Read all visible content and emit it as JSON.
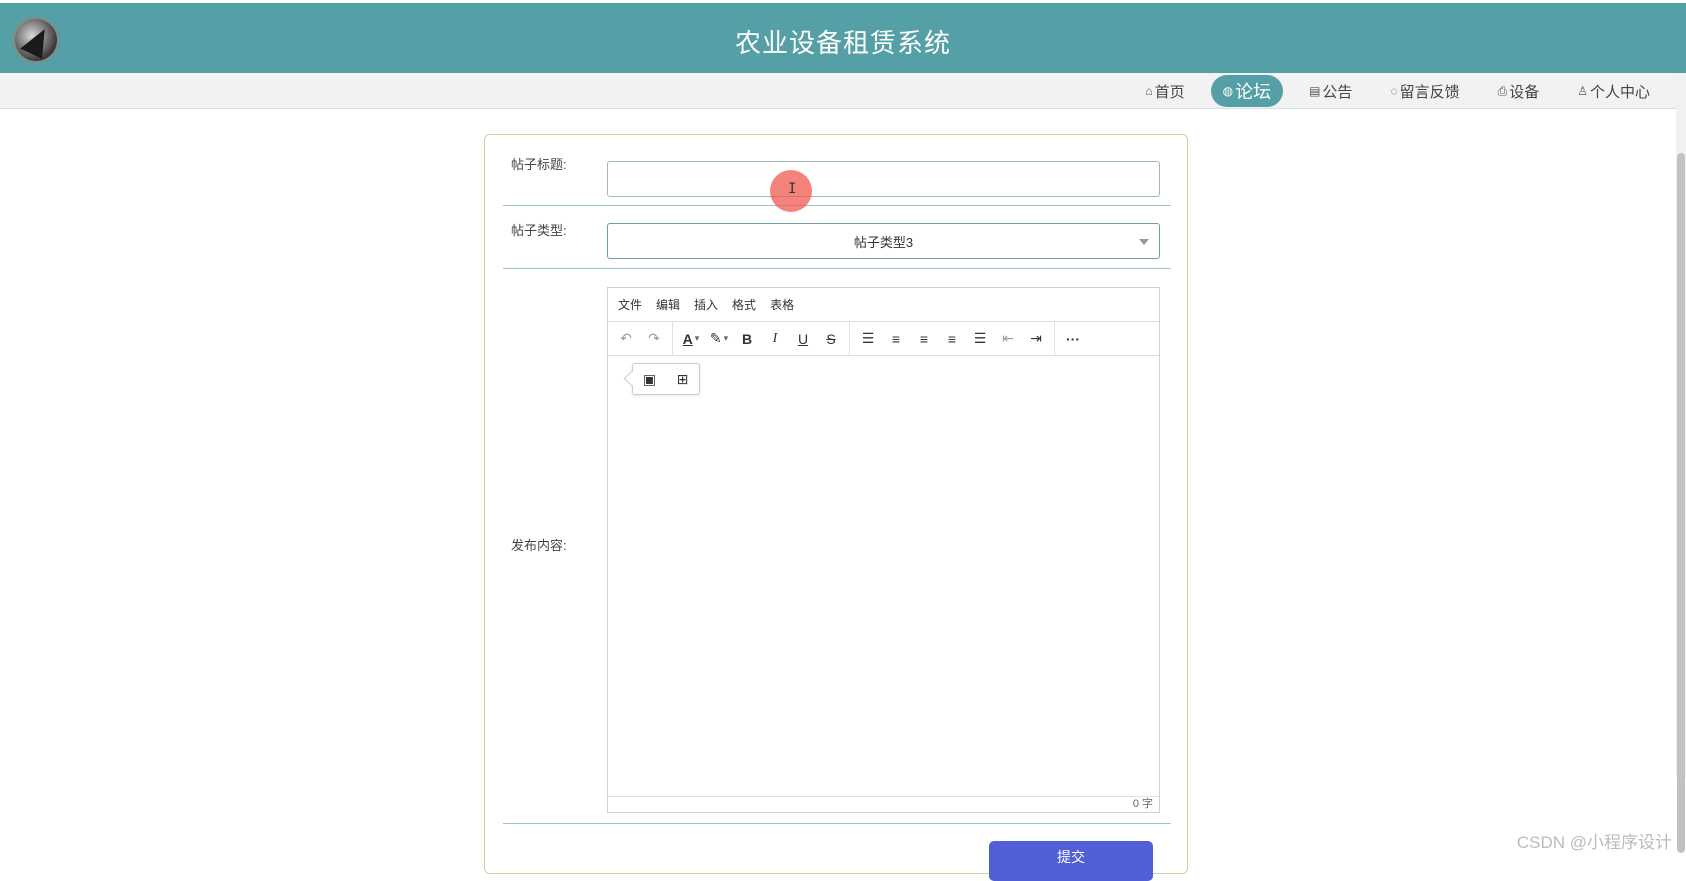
{
  "header": {
    "title": "农业设备租赁系统"
  },
  "nav": {
    "items": [
      {
        "icon": "home-icon",
        "glyph": "⌂",
        "label": "首页"
      },
      {
        "icon": "globe-icon",
        "glyph": "◍",
        "label": "论坛"
      },
      {
        "icon": "notice-icon",
        "glyph": "▤",
        "label": "公告"
      },
      {
        "icon": "feedback-icon",
        "glyph": "◌",
        "label": "留言反馈"
      },
      {
        "icon": "printer-icon",
        "glyph": "⎙",
        "label": "设备"
      },
      {
        "icon": "user-icon",
        "glyph": "♙",
        "label": "个人中心"
      }
    ],
    "active_index": 1
  },
  "form": {
    "title_label": "帖子标题:",
    "title_value": "",
    "type_label": "帖子类型:",
    "type_value": "帖子类型3",
    "content_label": "发布内容:",
    "submit_label": "提交"
  },
  "editor": {
    "menus": [
      "文件",
      "编辑",
      "插入",
      "格式",
      "表格"
    ],
    "word_count": "0 字"
  },
  "watermark": "CSDN @小程序设计",
  "colors": {
    "brand": "#559fa6",
    "submit": "#5160d4",
    "card_border": "#b8dba0"
  }
}
